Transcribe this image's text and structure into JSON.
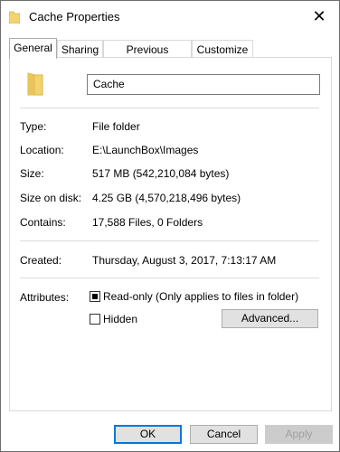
{
  "window": {
    "title": "Cache Properties",
    "close_label": "✕"
  },
  "tabs": [
    {
      "label": "General",
      "active": true
    },
    {
      "label": "Sharing",
      "active": false
    },
    {
      "label": "Previous Versions",
      "active": false
    },
    {
      "label": "Customize",
      "active": false
    }
  ],
  "folder": {
    "name": "Cache",
    "icon": "folder-icon",
    "icon_color": "#f3d36b"
  },
  "details": [
    {
      "label": "Type:",
      "value": "File folder"
    },
    {
      "label": "Location:",
      "value": "E:\\LaunchBox\\Images"
    },
    {
      "label": "Size:",
      "value": "517 MB (542,210,084 bytes)"
    },
    {
      "label": "Size on disk:",
      "value": "4.25 GB (4,570,218,496 bytes)"
    },
    {
      "label": "Contains:",
      "value": "17,588 Files, 0 Folders"
    }
  ],
  "created": {
    "label": "Created:",
    "value": "Thursday, August 3, 2017, 7:13:17 AM"
  },
  "attributes": {
    "label": "Attributes:",
    "readonly_label": "Read-only (Only applies to files in folder)",
    "readonly_state": "indeterminate",
    "hidden_label": "Hidden",
    "hidden_state": "unchecked",
    "advanced_label": "Advanced..."
  },
  "buttons": {
    "ok": "OK",
    "cancel": "Cancel",
    "apply": "Apply"
  },
  "colors": {
    "accent": "#0078d7"
  }
}
